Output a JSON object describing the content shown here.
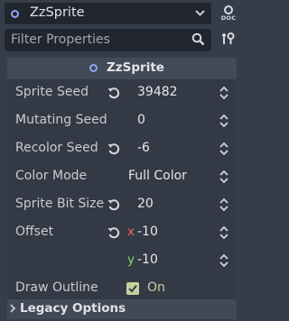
{
  "header": {
    "object_name": "ZzSprite",
    "doc_label": "DOC"
  },
  "filter": {
    "placeholder": "Filter Properties"
  },
  "section": {
    "title": "ZzSprite"
  },
  "properties": [
    {
      "label": "Sprite Seed",
      "value": "39482",
      "revert": true,
      "spin": true
    },
    {
      "label": "Mutating Seed",
      "value": "0",
      "revert": false,
      "spin": true
    },
    {
      "label": "Recolor Seed",
      "value": "-6",
      "revert": true,
      "spin": true
    },
    {
      "label": "Color Mode",
      "value": "Full Color",
      "revert": false,
      "spin": true
    },
    {
      "label": "Sprite Bit Size",
      "value": "20",
      "revert": true,
      "spin": true
    }
  ],
  "offset": {
    "label": "Offset",
    "x_axis": "x",
    "x_value": "-10",
    "y_axis": "y",
    "y_value": "-10"
  },
  "draw_outline": {
    "label": "Draw Outline",
    "value": "On",
    "checked": true
  },
  "legacy": {
    "label": "Legacy Options"
  },
  "colors": {
    "accent_circle": "#8da5f3",
    "axis_x": "#e56b6b",
    "axis_y": "#84d76e",
    "checkbox": "#c7cf9e"
  }
}
